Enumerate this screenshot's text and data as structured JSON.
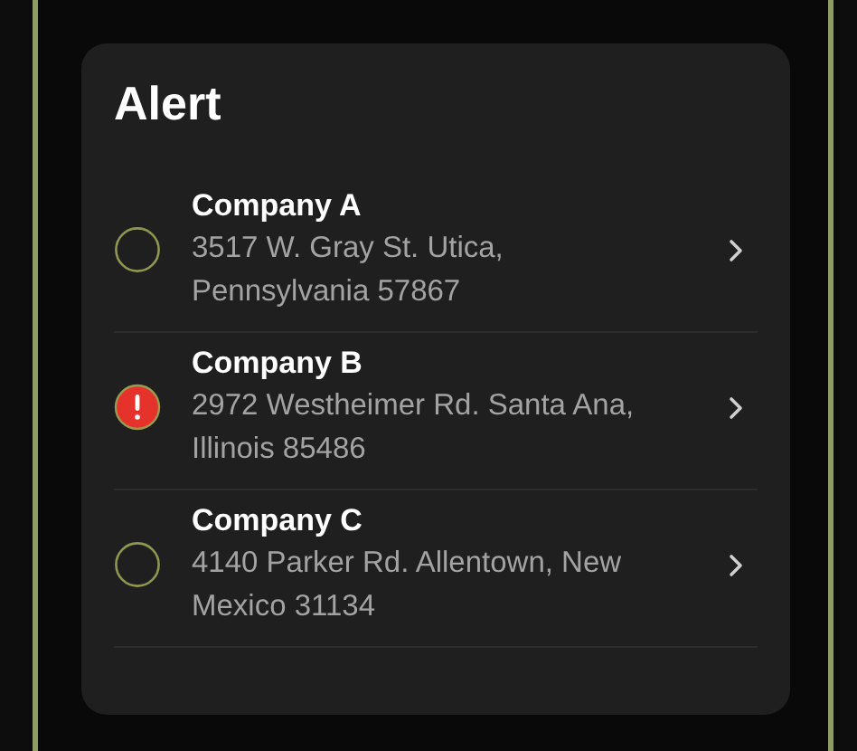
{
  "card": {
    "title": "Alert"
  },
  "items": [
    {
      "name": "Company A",
      "address": "3517 W. Gray St. Utica, Pennsylvania 57867",
      "flagged": false
    },
    {
      "name": "Company B",
      "address": "2972 Westheimer Rd. Santa Ana, Illinois 85486",
      "flagged": true
    },
    {
      "name": "Company C",
      "address": "4140 Parker Rd. Allentown, New Mexico 31134",
      "flagged": false
    }
  ]
}
